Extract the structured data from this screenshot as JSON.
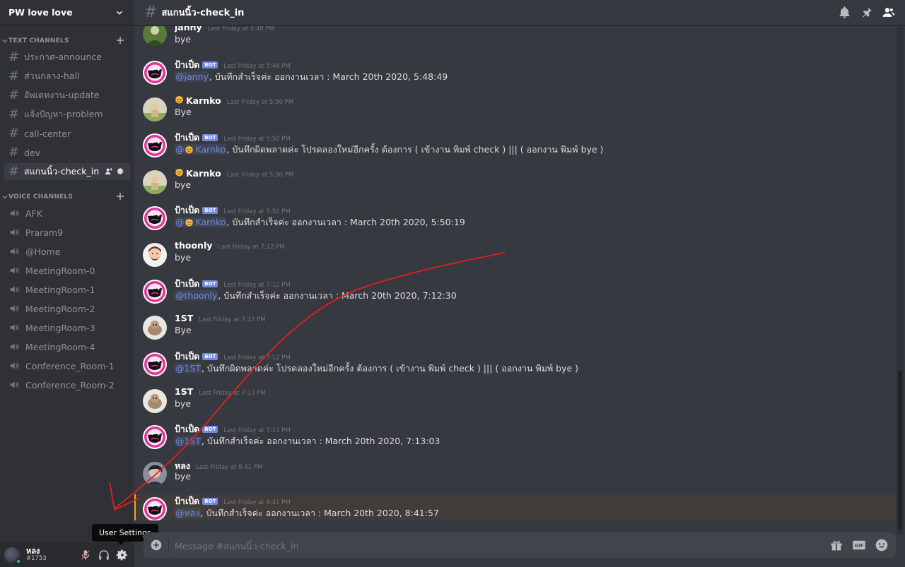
{
  "server": {
    "name": "PW love love"
  },
  "categories": {
    "text": "TEXT CHANNELS",
    "voice": "VOICE CHANNELS"
  },
  "text_channels": [
    "ประกาศ-announce",
    "ส่วนกลาง-hall",
    "อัพเดทงาน-update",
    "แจ้งปัญหา-problem",
    "call-center",
    "dev",
    "สแกนนิ้ว-check_in"
  ],
  "voice_channels": [
    "AFK",
    "Praram9",
    "@Home",
    "MeetingRoom-0",
    "MeetingRoom-1",
    "MeetingRoom-2",
    "MeetingRoom-3",
    "MeetingRoom-4",
    "Conference_Room-1",
    "Conference_Room-2"
  ],
  "header": {
    "channel": "สแกนนิ้ว-check_in"
  },
  "user": {
    "name": "หลง",
    "tag": "#1753",
    "tooltip": "User Settings"
  },
  "composer": {
    "placeholder": "Message #สแกนนิ้ว-check_in"
  },
  "bot_badge": "BOT",
  "messages": [
    {
      "author": "janny",
      "time": "Last Friday at 5:48 PM",
      "text": "bye"
    },
    {
      "author": "ป้าเป็ด",
      "time": "Last Friday at 5:48 PM",
      "mention": "@janny",
      "text": ", บันทึกสำเร็จค่ะ ออกงานเวลา : March 20th 2020, 5:48:49"
    },
    {
      "author": "Karnko",
      "time": "Last Friday at 5:50 PM",
      "text": "Bye"
    },
    {
      "author": "ป้าเป็ด",
      "time": "Last Friday at 5:50 PM",
      "mention": "Karnko",
      "text": ", บันทึกผิดพลาดค่ะ โปรดลองใหม่อีกครั้ง ต้องการ ( เข้างาน พิมพ์ check ) ||| ( ออกงาน พิมพ์ bye )"
    },
    {
      "author": "Karnko",
      "time": "Last Friday at 5:50 PM",
      "text": "bye"
    },
    {
      "author": "ป้าเป็ด",
      "time": "Last Friday at 5:50 PM",
      "mention": "Karnko",
      "text": ", บันทึกสำเร็จค่ะ ออกงานเวลา : March 20th 2020, 5:50:19"
    },
    {
      "author": "thoonly",
      "time": "Last Friday at 7:12 PM",
      "text": "bye"
    },
    {
      "author": "ป้าเป็ด",
      "time": "Last Friday at 7:12 PM",
      "mention": "@thoonly",
      "text": ", บันทึกสำเร็จค่ะ ออกงานเวลา : March 20th 2020, 7:12:30"
    },
    {
      "author": "1ST",
      "time": "Last Friday at 7:12 PM",
      "text": "Bye"
    },
    {
      "author": "ป้าเป็ด",
      "time": "Last Friday at 7:12 PM",
      "mention": "@1ST",
      "text": ", บันทึกผิดพลาดค่ะ โปรดลองใหม่อีกครั้ง ต้องการ ( เข้างาน พิมพ์ check ) ||| ( ออกงาน พิมพ์ bye )"
    },
    {
      "author": "1ST",
      "time": "Last Friday at 7:13 PM",
      "text": "bye"
    },
    {
      "author": "ป้าเป็ด",
      "time": "Last Friday at 7:13 PM",
      "mention": "@1ST",
      "text": ", บันทึกสำเร็จค่ะ ออกงานเวลา : March 20th 2020, 7:13:03"
    },
    {
      "author": "หลง",
      "time": "Last Friday at 8:41 PM",
      "text": "bye"
    },
    {
      "author": "ป้าเป็ด",
      "time": "Last Friday at 8:41 PM",
      "mention": "@หลง",
      "text": ", บันทึกสำเร็จค่ะ ออกงานเวลา : March 20th 2020, 8:41:57"
    }
  ],
  "colors": {
    "accent": "#7289da",
    "annotation": "#e02020",
    "online": "#43b581"
  }
}
